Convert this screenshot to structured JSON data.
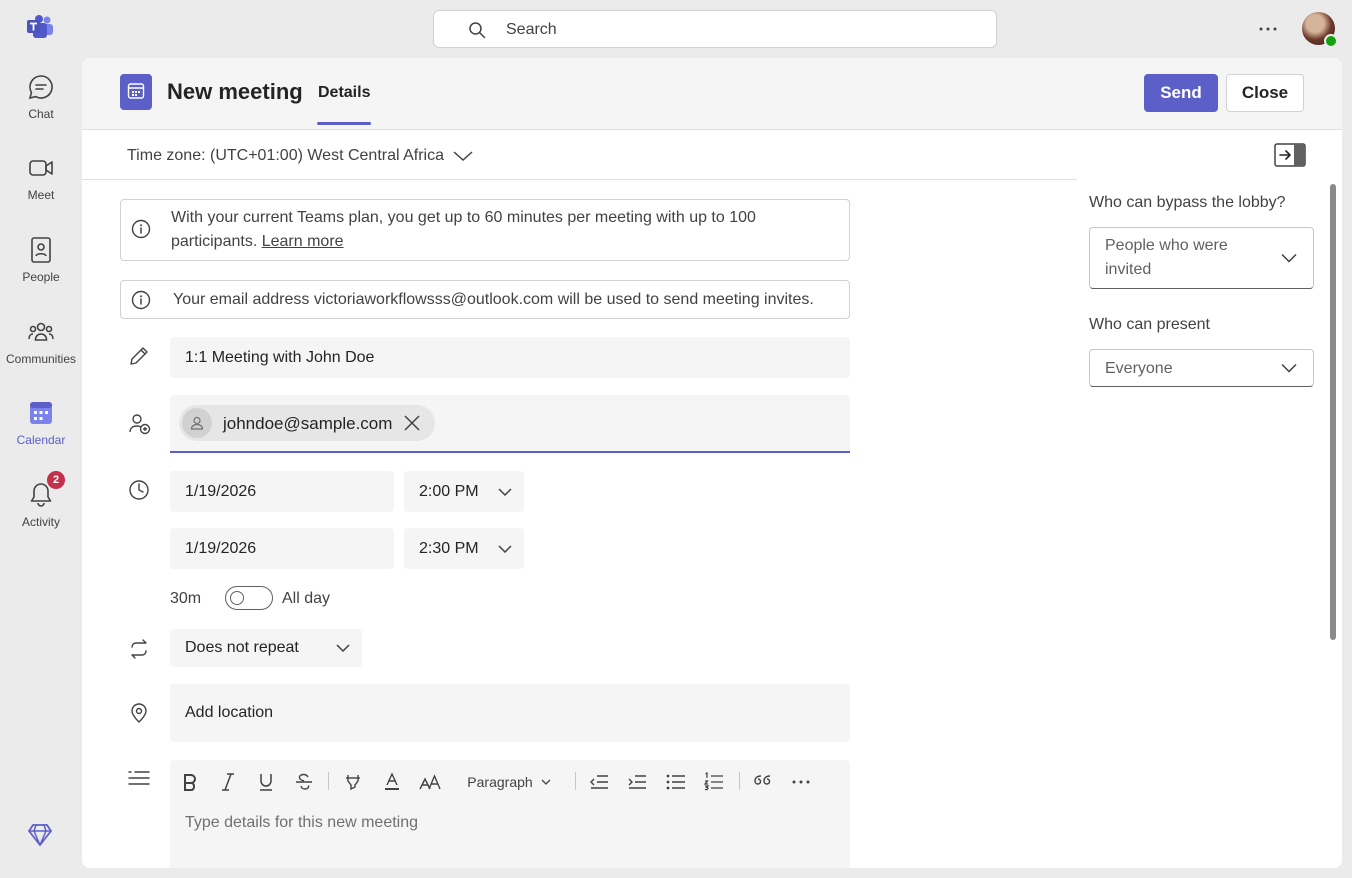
{
  "app_rail": {
    "items": [
      {
        "label": "Chat",
        "icon": "chat-icon"
      },
      {
        "label": "Meet",
        "icon": "video-icon"
      },
      {
        "label": "People",
        "icon": "contact-book-icon"
      },
      {
        "label": "Communities",
        "icon": "people-community-icon"
      },
      {
        "label": "Calendar",
        "icon": "calendar-icon",
        "active": true
      },
      {
        "label": "Activity",
        "icon": "bell-icon",
        "badge": "2"
      }
    ]
  },
  "search": {
    "placeholder": "Search"
  },
  "header": {
    "title": "New meeting",
    "tab": "Details",
    "send_label": "Send",
    "close_label": "Close"
  },
  "timezone": {
    "label": "Time zone: (UTC+01:00) West Central Africa"
  },
  "notices": {
    "plan_text": "With your current Teams plan, you get up to 60 minutes per meeting with up to 100 participants.",
    "plan_link": "Learn more",
    "email_text": "Your email address victoriaworkflowsss@outlook.com will be used to send meeting invites."
  },
  "form": {
    "title_value": "1:1 Meeting with John Doe",
    "attendee": "johndoe@sample.com",
    "start_date": "1/19/2026",
    "start_time": "2:00 PM",
    "end_date": "1/19/2026",
    "end_time": "2:30 PM",
    "duration": "30m",
    "all_day_label": "All day",
    "all_day_on": false,
    "repeat": "Does not repeat",
    "location_placeholder": "Add location",
    "details_placeholder": "Type details for this new meeting",
    "paragraph_label": "Paragraph"
  },
  "sidebar": {
    "lobby_label": "Who can bypass the lobby?",
    "lobby_value": "People who were invited",
    "present_label": "Who can present",
    "present_value": "Everyone"
  },
  "colors": {
    "accent": "#5b5fc7",
    "badge": "#c4314b",
    "presence": "#13a10e"
  }
}
